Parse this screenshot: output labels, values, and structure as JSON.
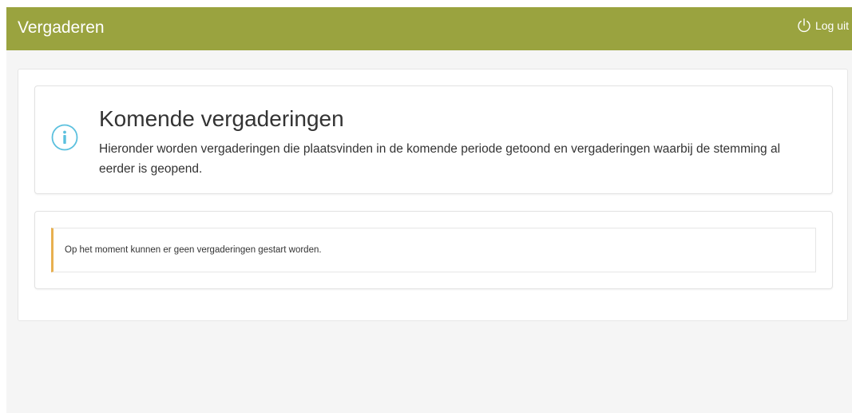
{
  "navbar": {
    "brand": "Vergaderen",
    "logout_label": "Log uit",
    "logout_icon": "power-icon",
    "background_color": "#9aa33f"
  },
  "info": {
    "icon": "info-icon",
    "icon_color": "#5bc0de",
    "title": "Komende vergaderingen",
    "description": "Hieronder worden vergaderingen die plaatsvinden in de komende periode getoond en vergaderingen waarbij de stemming al eerder is geopend."
  },
  "alert": {
    "message": "Op het moment kunnen er geen vergaderingen gestart worden.",
    "accent_color": "#e8b04f"
  }
}
